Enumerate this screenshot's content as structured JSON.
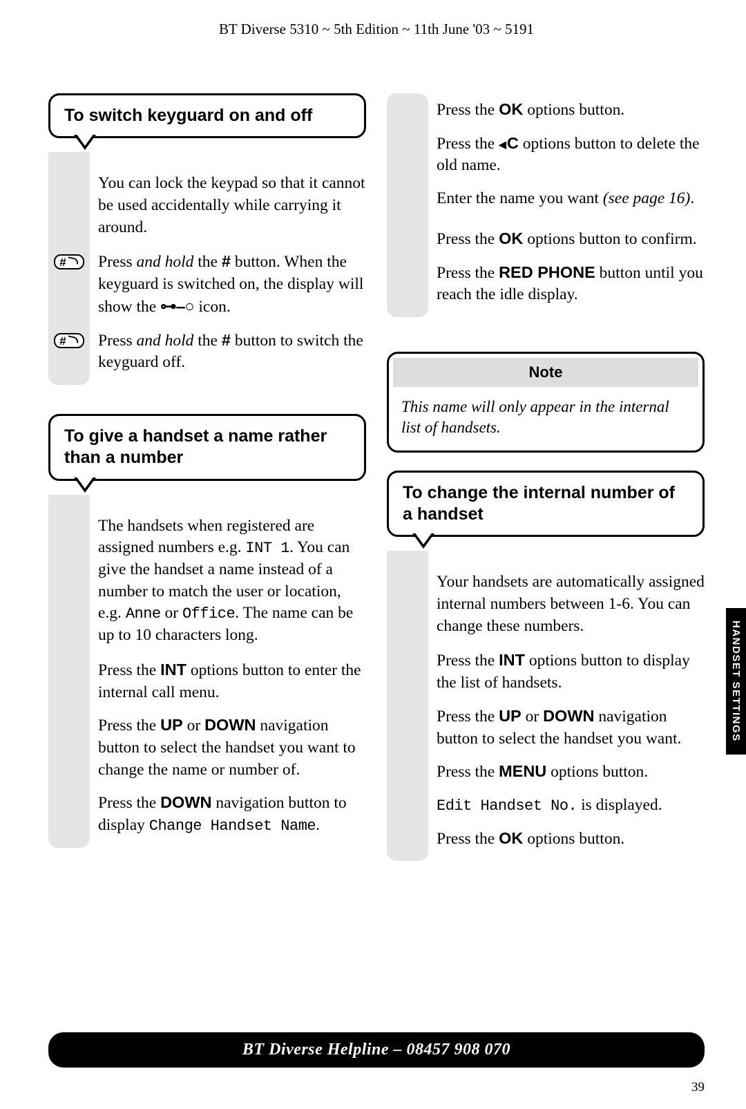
{
  "header": "BT Diverse 5310 ~ 5th Edition ~ 11th June '03 ~ 5191",
  "sideTab": "HANDSET SETTINGS",
  "footer": "BT Diverse Helpline – 08457 908 070",
  "pageNumber": "39",
  "sec1": {
    "title": "To switch keyguard on and off",
    "intro": "You can lock the keypad so that it cannot be used accidentally while carrying it around.",
    "step1a": "Press ",
    "step1b": "and hold",
    "step1c": " the ",
    "step1d": " button. When the keyguard is switched on, the display will show the ",
    "step1e": " icon.",
    "step2a": "Press ",
    "step2b": "and hold",
    "step2c": " the ",
    "step2d": " button to switch the keyguard off."
  },
  "sec2": {
    "title": "To give a handset a name rather than a number",
    "introA": "The handsets when registered are assigned numbers e.g. ",
    "introAcode": "INT 1",
    "introB": ". You can give the handset a name instead of a number to match the user or location, e.g. ",
    "introBcode1": "Anne",
    "introBmid": " or ",
    "introBcode2": "Office",
    "introC": ". The name can be up to 10 characters long.",
    "s1label": "INT",
    "s1a": "Press the ",
    "s1b": "INT",
    "s1c": " options button to enter the internal call menu.",
    "s2a": "Press the ",
    "s2b": "UP",
    "s2c": " or ",
    "s2d": "DOWN",
    "s2e": " navigation button to select the handset you want to change the name or number of.",
    "s3a": "Press the ",
    "s3b": "DOWN",
    "s3c": " navigation button to display ",
    "s3code": "Change Handset Name",
    "s3d": "."
  },
  "right1": {
    "r1label": "OK",
    "r1a": "Press the ",
    "r1b": "OK",
    "r1c": " options button.",
    "r2pre": "C",
    "r2a": "Press the ",
    "r2b": "C",
    "r2c": " options button to delete the old name.",
    "r3a": "Enter the name you want ",
    "r3b": "(see page 16)",
    "r3c": ".",
    "r4label": "OK",
    "r4a": "Press the ",
    "r4b": "OK",
    "r4c": " options button to confirm.",
    "r5a": "Press the ",
    "r5b": "RED PHONE",
    "r5c": " button until you reach the idle display."
  },
  "note": {
    "title": "Note",
    "body": "This name will only appear in the internal list of handsets."
  },
  "sec3": {
    "title": "To change the internal number of a handset",
    "intro": "Your handsets are automatically assigned internal numbers between 1-6. You can change these numbers.",
    "s1label": "INT",
    "s1a": "Press the ",
    "s1b": "INT",
    "s1c": " options button to display the list of handsets.",
    "s2a": "Press the ",
    "s2b": "UP",
    "s2c": " or ",
    "s2d": "DOWN",
    "s2e": " navigation button to select the handset you want.",
    "s3label": "MENU",
    "s3a": "Press the ",
    "s3b": "MENU",
    "s3c": " options button.",
    "s4code": "Edit Handset No.",
    "s4a": " is displayed.",
    "s5label": "OK",
    "s5a": "Press the ",
    "s5b": "OK",
    "s5c": " options button."
  }
}
